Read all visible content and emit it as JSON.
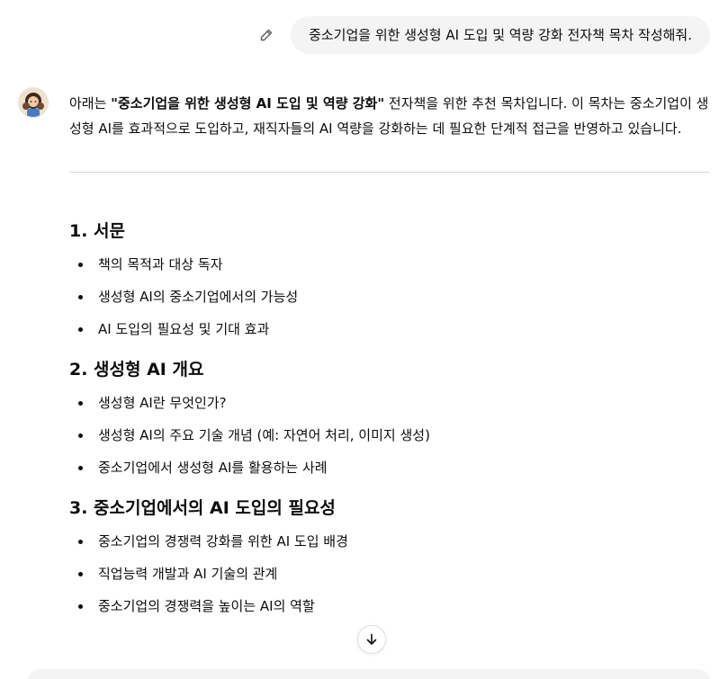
{
  "user_message": {
    "text": "중소기업을 위한 생성형 AI 도입 및 역량 강화 전자책 목차 작성해줘."
  },
  "assistant": {
    "intro_before": "아래는 ",
    "intro_bold": "\"중소기업을 위한 생성형 AI 도입 및 역량 강화\"",
    "intro_after": " 전자책을 위한 추천 목차입니다. 이 목차는 중소기업이 생성형 AI를 효과적으로 도입하고, 재직자들의 AI 역량을 강화하는 데 필요한 단계적 접근을 반영하고 있습니다.",
    "sections": [
      {
        "title": "1. 서문",
        "items": [
          "책의 목적과 대상 독자",
          "생성형 AI의 중소기업에서의 가능성",
          "AI 도입의 필요성 및 기대 효과"
        ]
      },
      {
        "title": "2. 생성형 AI 개요",
        "items": [
          "생성형 AI란 무엇인가?",
          "생성형 AI의 주요 기술 개념 (예: 자연어 처리, 이미지 생성)",
          "중소기업에서 생성형 AI를 활용하는 사례"
        ]
      },
      {
        "title": "3. 중소기업에서의 AI 도입의 필요성",
        "items": [
          "중소기업의 경쟁력 강화를 위한 AI 도입 배경",
          "직업능력 개발과 AI 기술의 관계",
          "중소기업의 경쟁력을 높이는 AI의 역할"
        ]
      }
    ]
  },
  "icons": {
    "edit": "pencil-icon",
    "scroll": "arrow-down-icon",
    "avatar": "user-avatar"
  },
  "colors": {
    "bubble_bg": "#f4f4f4",
    "text": "#0d0d0d",
    "divider": "#d9d9d9"
  }
}
